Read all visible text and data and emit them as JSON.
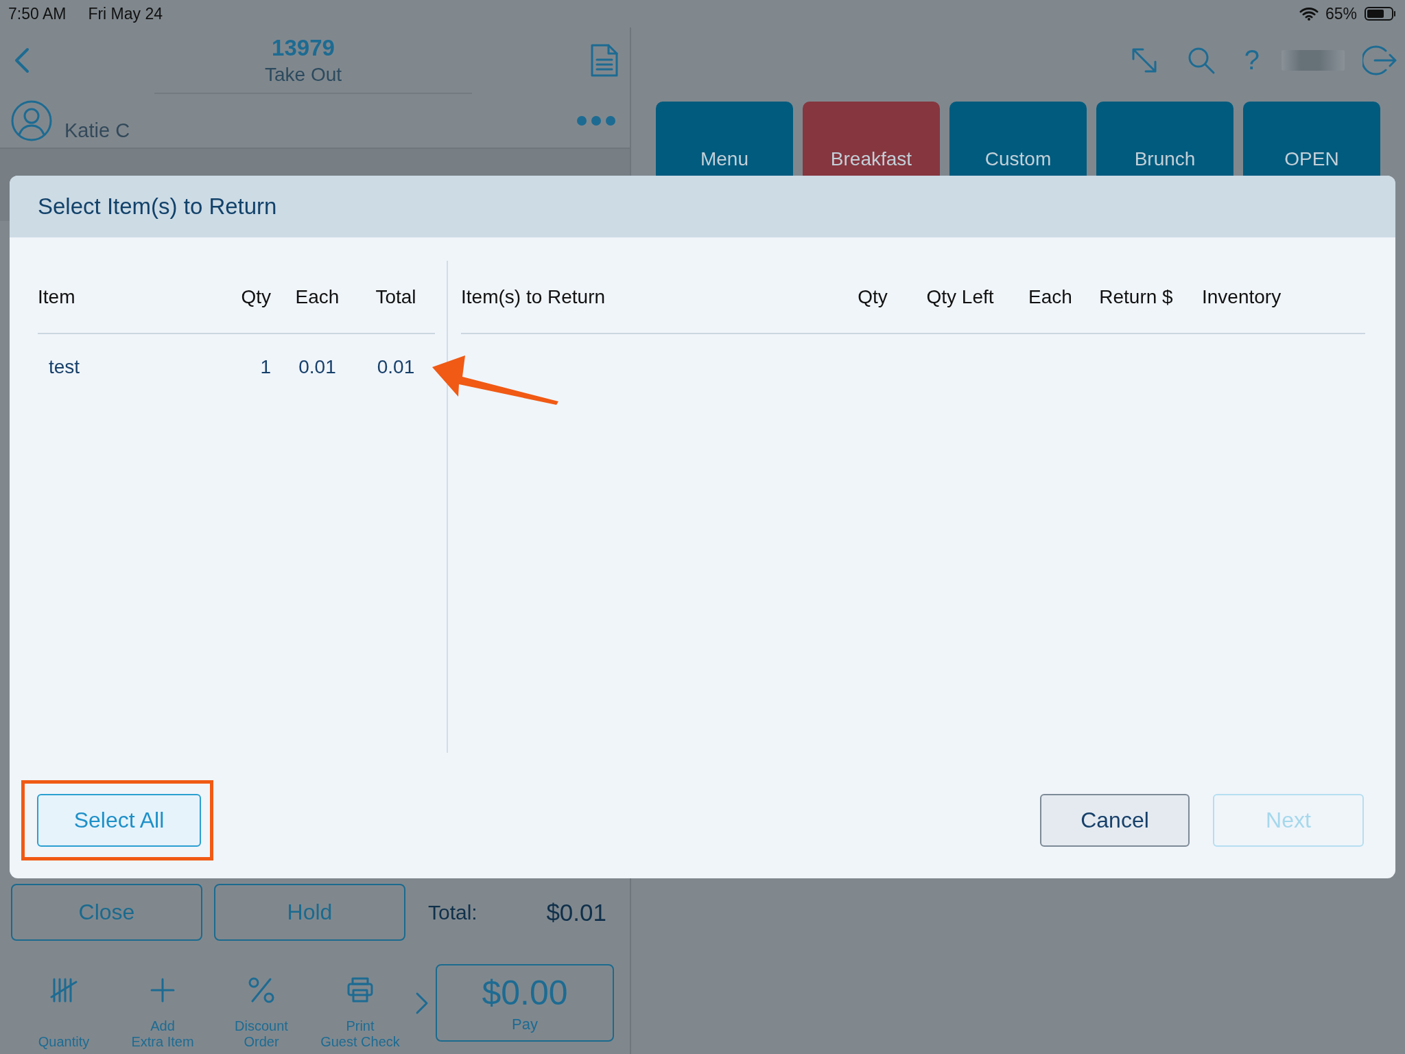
{
  "status_bar": {
    "time": "7:50 AM",
    "date": "Fri May 24",
    "battery": "65%"
  },
  "header": {
    "order_number": "13979",
    "order_type": "Take Out",
    "help": "?"
  },
  "user": {
    "name": "Katie C"
  },
  "menu_tiles": [
    {
      "label": "Menu",
      "color": "#005b7e"
    },
    {
      "label": "Breakfast",
      "color": "#86363f"
    },
    {
      "label": "Custom",
      "color": "#005b7e"
    },
    {
      "label": "Brunch",
      "color": "#005b7e"
    },
    {
      "label": "OPEN",
      "color": "#005b7e"
    }
  ],
  "dialog": {
    "title": "Select Item(s) to Return",
    "order_table": {
      "columns": [
        "Item",
        "Qty",
        "Each",
        "Total"
      ],
      "rows": [
        {
          "cells": [
            "test",
            "1",
            "0.01",
            "0.01"
          ],
          "arrow": true
        }
      ]
    },
    "return_table": {
      "columns": [
        "Item(s) to Return",
        "Qty",
        "Qty Left",
        "Each",
        "Return $",
        "Inventory"
      ]
    },
    "buttons": [
      {
        "label": "Select All",
        "kind": "select",
        "highlighted": true,
        "disabled": false
      },
      {
        "label": "Cancel",
        "kind": "cancel",
        "highlighted": false,
        "disabled": false
      },
      {
        "label": "Next",
        "kind": "next",
        "highlighted": false,
        "disabled": true
      }
    ]
  },
  "order_actions": [
    "Close",
    "Hold"
  ],
  "total": {
    "label": "Total:",
    "value": "$0.01"
  },
  "toolbar": [
    {
      "label": "Quantity",
      "kind": "tally"
    },
    {
      "label": "Add\nExtra Item",
      "kind": "plus"
    },
    {
      "label": "Discount\nOrder",
      "kind": "percent"
    },
    {
      "label": "Print\nGuest Check",
      "kind": "printer"
    }
  ],
  "pay": {
    "amount": "$0.00",
    "label": "Pay"
  }
}
